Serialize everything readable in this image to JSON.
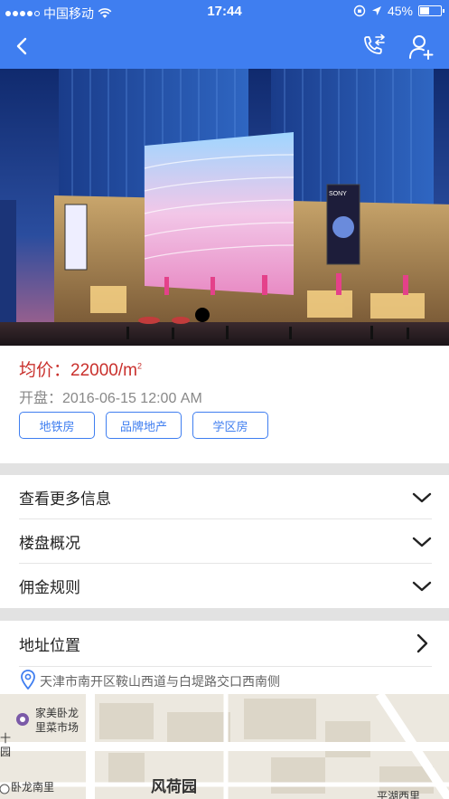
{
  "status_bar": {
    "carrier": "中国移动",
    "time": "17:44",
    "battery": "45%",
    "battery_level": 0.45,
    "signal_bars": 4
  },
  "nav": {
    "back_icon": "chevron-left-icon",
    "call_icon": "phone-transfer-icon",
    "user_icon": "add-user-icon"
  },
  "hero": {
    "image": "shopping-mall-night-photo",
    "sign_text": "SONY"
  },
  "listing": {
    "price_label": "均价：",
    "price_value": "22000/m",
    "price_unit_sup": "2",
    "opening_label": "开盘：",
    "opening_value": "2016-06-15 12:00 AM",
    "tags": [
      "地铁房",
      "品牌地产",
      "学区房"
    ]
  },
  "sections": [
    {
      "label": "查看更多信息",
      "icon": "chevron-down-icon"
    },
    {
      "label": "楼盘概况",
      "icon": "chevron-down-icon"
    },
    {
      "label": "佣金规则",
      "icon": "chevron-down-icon"
    }
  ],
  "location": {
    "label": "地址位置",
    "icon": "chevron-right-icon",
    "address": "天津市南开区鞍山西道与白堤路交口西南侧",
    "pin_icon": "location-pin-icon"
  },
  "map": {
    "labels": [
      "家美卧龙",
      "里菜市场",
      "卧龙南里",
      "风荷园",
      "平湖西里",
      "十",
      "园"
    ]
  },
  "colors": {
    "primary": "#3f7ef0",
    "price": "#c9302c",
    "separator": "#e2e2e2"
  }
}
